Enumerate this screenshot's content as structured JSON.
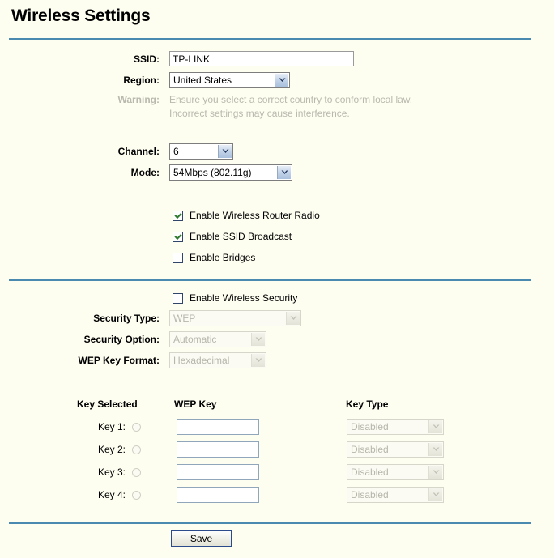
{
  "page": {
    "title": "Wireless Settings"
  },
  "basic": {
    "ssid": {
      "label": "SSID:",
      "value": "TP-LINK"
    },
    "region": {
      "label": "Region:",
      "value": "United States"
    },
    "warning": {
      "label": "Warning:",
      "line1": "Ensure you select a correct country to conform local law.",
      "line2": "Incorrect settings may cause interference."
    },
    "channel": {
      "label": "Channel:",
      "value": "6"
    },
    "mode": {
      "label": "Mode:",
      "value": "54Mbps (802.11g)"
    }
  },
  "toggles": [
    {
      "label": "Enable Wireless Router Radio",
      "checked": true
    },
    {
      "label": "Enable SSID Broadcast",
      "checked": true
    },
    {
      "label": "Enable Bridges",
      "checked": false
    }
  ],
  "security": {
    "enable": {
      "label": "Enable Wireless Security",
      "checked": false
    },
    "type": {
      "label": "Security Type:",
      "value": "WEP"
    },
    "option": {
      "label": "Security Option:",
      "value": "Automatic"
    },
    "key_format": {
      "label": "WEP Key Format:",
      "value": "Hexadecimal"
    }
  },
  "key_table": {
    "headers": {
      "selected": "Key Selected",
      "wep_key": "WEP Key",
      "key_type": "Key Type"
    },
    "rows": [
      {
        "label": "Key 1:",
        "value": "",
        "type": "Disabled",
        "selected": false
      },
      {
        "label": "Key 2:",
        "value": "",
        "type": "Disabled",
        "selected": false
      },
      {
        "label": "Key 3:",
        "value": "",
        "type": "Disabled",
        "selected": false
      },
      {
        "label": "Key 4:",
        "value": "",
        "type": "Disabled",
        "selected": false
      }
    ]
  },
  "actions": {
    "save": "Save"
  },
  "colors": {
    "background": "#fdfdf0",
    "rule": "#4a8ab0",
    "check": "#2f7a2f",
    "disabled_text": "#b6b6ac"
  }
}
